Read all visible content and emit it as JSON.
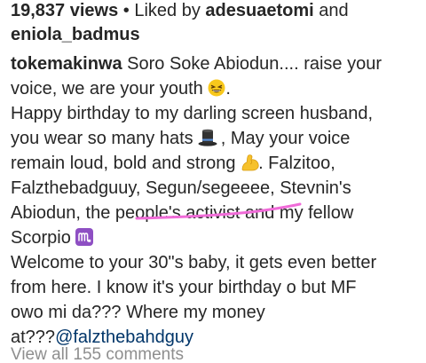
{
  "likes": {
    "views": "19,837 views",
    "separator": " • ",
    "liked_by_text": "Liked by ",
    "liker1": "adesuaetomi",
    "and_text": " and",
    "liker2": "eniola_badmus"
  },
  "caption": {
    "author": "tokemakinwa",
    "line1_rest": " Soro Soke Abiodun.... raise your",
    "line2": "voice, we are your youth ",
    "line2_end": ".",
    "line3": "Happy birthday to my darling screen husband,",
    "line4_a": "you wear so many hats ",
    "line4_b": " , May your voice",
    "line5_a": "remain  loud, bold and strong ",
    "line5_b": ". Falzitoo,",
    "line6": "Falzthebadguuy, Segun/segeeee, Stevnin's",
    "line7": "Abiodun, the people's activist  and my fellow",
    "line8_a": "Scorpio ",
    "line9": "Welcome to your 30\"s baby, it gets even better",
    "line10": "from here. I know it's your birthday o but MF",
    "line11": "owo mi da??? Where my money",
    "line12_a": "at???",
    "line12_mention": "@falzthebahdguy"
  },
  "comments": {
    "view_all": "View all 155 comments"
  },
  "icons": {
    "grin": "grinning-squinting-face-icon",
    "hat": "top-hat-icon",
    "muscle": "flexed-biceps-icon",
    "scorpio": "scorpio-sign-icon"
  },
  "colors": {
    "text": "#262626",
    "mention": "#003569",
    "muted": "#8e8e8e",
    "highlight": "#f06bd8",
    "emoji_yellow": "#f8c81c",
    "scorpio_purple": "#8e4fc3"
  }
}
